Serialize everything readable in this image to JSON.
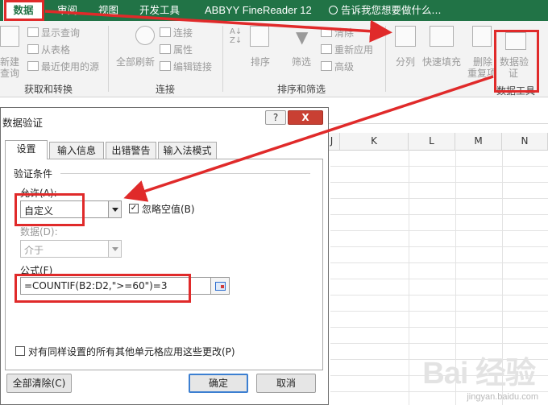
{
  "ribbon_tabs": {
    "data": "数据",
    "review": "审阅",
    "view": "视图",
    "developer": "开发工具",
    "abbyy": "ABBYY FineReader 12",
    "tell_me": "告诉我您想要做什么..."
  },
  "ribbon": {
    "new_query_1": "新建",
    "new_query_2": "查询",
    "show_queries": "显示查询",
    "from_table": "从表格",
    "recent_sources": "最近使用的源",
    "group_get_transform": "获取和转换",
    "refresh_all": "全部刷新",
    "connections": "连接",
    "properties": "属性",
    "edit_links": "编辑链接",
    "group_connections": "连接",
    "sort": "排序",
    "filter": "筛选",
    "clear": "清除",
    "reapply": "重新应用",
    "advanced": "高级",
    "group_sort_filter": "排序和筛选",
    "text_to_columns": "分列",
    "flash_fill": "快速填充",
    "remove_dup_1": "删除",
    "remove_dup_2": "重复项",
    "data_validation_1": "数据验",
    "data_validation_2": "证",
    "group_data_tools": "数据工具"
  },
  "sheet": {
    "columns": [
      "J",
      "K",
      "L",
      "M",
      "N"
    ]
  },
  "dialog": {
    "title": "数据验证",
    "help": "?",
    "close": "X",
    "tabs": {
      "settings": "设置",
      "input_message": "输入信息",
      "error_alert": "出错警告",
      "ime_mode": "输入法模式"
    },
    "criteria_heading": "验证条件",
    "allow_label": "允许(A):",
    "allow_value": "自定义",
    "ignore_blank": "忽略空值(B)",
    "ignore_blank_checked": true,
    "data_label": "数据(D):",
    "data_value": "介于",
    "formula_label": "公式(F)",
    "formula_value": "=COUNTIF(B2:D2,\">=60\")=3",
    "apply_all": "对有同样设置的所有其他单元格应用这些更改(P)",
    "clear_all": "全部清除(C)",
    "ok": "确定",
    "cancel": "取消"
  },
  "watermark": {
    "logo": "Bai 经验",
    "url": "jingyan.baidu.com"
  },
  "colors": {
    "excel_green": "#217346",
    "highlight_red": "#e02a2a",
    "ok_border": "#3c7fd1"
  }
}
